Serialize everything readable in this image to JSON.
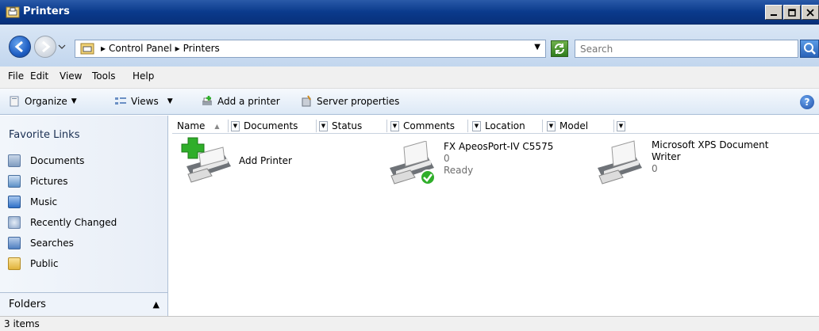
{
  "window": {
    "title": "Printers"
  },
  "address": {
    "crumbs": [
      "Control Panel",
      "Printers"
    ],
    "search_placeholder": "Search"
  },
  "menu": [
    "File",
    "Edit",
    "View",
    "Tools",
    "Help"
  ],
  "toolbar": {
    "organize": "Organize",
    "views": "Views",
    "add_printer": "Add a printer",
    "server_properties": "Server properties"
  },
  "nav": {
    "favorite_links_title": "Favorite Links",
    "items": [
      "Documents",
      "Pictures",
      "Music",
      "Recently Changed",
      "Searches",
      "Public"
    ],
    "folders_label": "Folders"
  },
  "columns": [
    "Name",
    "Documents",
    "Status",
    "Comments",
    "Location",
    "Model"
  ],
  "items": [
    {
      "name": "Add Printer"
    },
    {
      "name": "FX ApeosPort-IV C5575",
      "documents": "0",
      "status": "Ready"
    },
    {
      "name": "Microsoft XPS Document",
      "name2": "Writer",
      "documents": "0"
    }
  ],
  "status": {
    "text": "3 items"
  },
  "colors": {
    "title_bar": "#0a3a8c",
    "accent_green": "#2fae2a",
    "link_text": "#1a2f52"
  }
}
